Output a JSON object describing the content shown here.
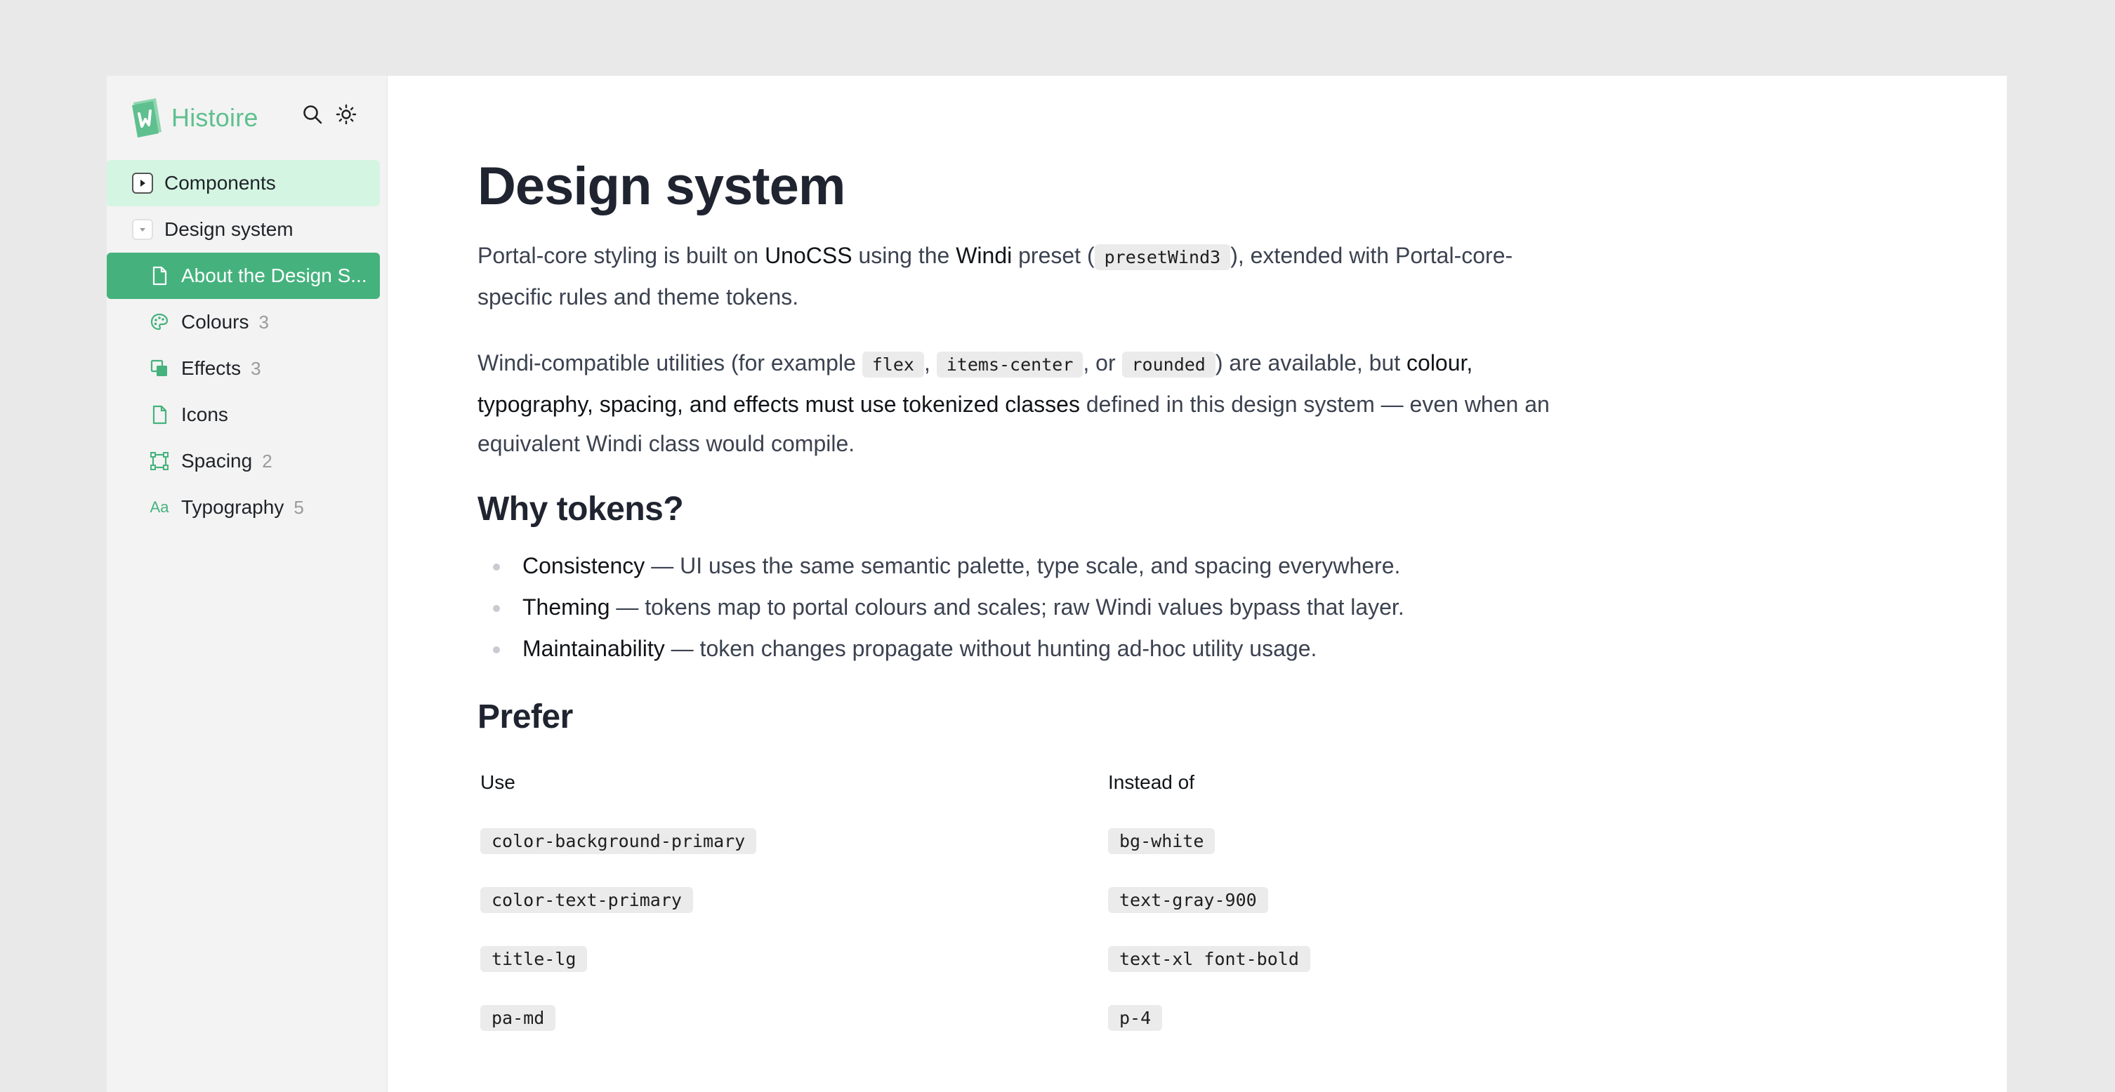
{
  "app": {
    "logo_text": "Histoire"
  },
  "colors": {
    "brand": "#5fc08f",
    "selected": "#45b27d",
    "active_group_bg": "#d5f5e3",
    "page_bg": "#e9e9e9"
  },
  "sidebar": {
    "icons": {
      "search": "search-icon",
      "theme": "sun-icon"
    },
    "items": [
      {
        "label": "Components",
        "kind": "group",
        "state": "collapsed",
        "icon": "triangle-right-icon"
      },
      {
        "label": "Design system",
        "kind": "group",
        "state": "expanded",
        "icon": "triangle-down-icon"
      },
      {
        "label": "About the Design S...",
        "kind": "leaf",
        "icon": "document-icon",
        "selected": true
      },
      {
        "label": "Colours",
        "kind": "leaf",
        "icon": "palette-icon",
        "count": "3"
      },
      {
        "label": "Effects",
        "kind": "leaf",
        "icon": "layers-icon",
        "count": "3"
      },
      {
        "label": "Icons",
        "kind": "leaf",
        "icon": "document-icon"
      },
      {
        "label": "Spacing",
        "kind": "leaf",
        "icon": "frame-icon",
        "count": "2"
      },
      {
        "label": "Typography",
        "kind": "leaf",
        "icon": "text-aa-icon",
        "icon_text": "Aa",
        "count": "5"
      }
    ]
  },
  "main": {
    "title": "Design system",
    "intro": {
      "t1": "Portal-core styling is built on ",
      "unocss": "UnoCSS",
      "t2": " using the ",
      "windi": "Windi",
      "t3": " preset (",
      "code_preset": "presetWind3",
      "t4": "), extended with Portal-core-specific rules and theme tokens."
    },
    "windi_para": {
      "t1": "Windi-compatible utilities (for example ",
      "code_flex": "flex",
      "sep1": ", ",
      "code_items": "items-center",
      "sep2": ", or ",
      "code_rounded": "rounded",
      "t2": ") are available, but ",
      "bold": "colour, typography, spacing, and effects must use tokenized classes",
      "t3": " defined in this design system — even when an equivalent Windi class would compile."
    },
    "why_heading": "Why tokens?",
    "why_items": [
      {
        "term": "Consistency",
        "text": " — UI uses the same semantic palette, type scale, and spacing everywhere."
      },
      {
        "term": "Theming",
        "text": " — tokens map to portal colours and scales; raw Windi values bypass that layer."
      },
      {
        "term": "Maintainability",
        "text": " — token changes propagate without hunting ad-hoc utility usage."
      }
    ],
    "prefer_heading": "Prefer",
    "prefer_table": {
      "headers": [
        "Use",
        "Instead of"
      ],
      "rows": [
        [
          "color-background-primary",
          "bg-white"
        ],
        [
          "color-text-primary",
          "text-gray-900"
        ],
        [
          "title-lg",
          "text-xl font-bold"
        ],
        [
          "pa-md",
          "p-4"
        ]
      ]
    }
  }
}
